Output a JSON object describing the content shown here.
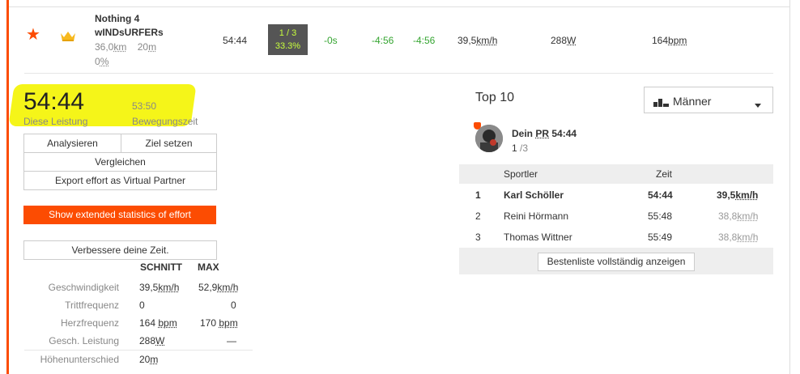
{
  "segment": {
    "name_line1": "Nothing 4",
    "name_line2": "wINDsURFERs",
    "distance": "36,0",
    "distance_unit": "km",
    "elevation": "20",
    "elevation_unit": "m",
    "grade": "0",
    "grade_unit": "%",
    "time": "54:44",
    "rank": "1 / 3",
    "rank_pct": "33.3%",
    "diff1": "-0s",
    "diff2": "-4:56",
    "diff3": "-4:56",
    "speed": "39,5",
    "speed_unit": "km/h",
    "power": "288",
    "power_unit": "W",
    "hr": "164",
    "hr_unit": "bpm"
  },
  "effort": {
    "time": "54:44",
    "time_label": "Diese Leistung",
    "moving_time": "53:50",
    "moving_label": "Bewegungszeit"
  },
  "buttons": {
    "analyze": "Analysieren",
    "set_goal": "Ziel setzen",
    "compare": "Vergleichen",
    "export": "Export effort as Virtual Partner",
    "extended": "Show extended statistics of effort",
    "improve": "Verbessere deine Zeit."
  },
  "stats": {
    "col_avg": "SCHNITT",
    "col_max": "MAX",
    "rows": [
      {
        "label": "Geschwindigkeit",
        "avg": "39,5",
        "avg_unit": "km/h",
        "max": "52,9",
        "max_unit": "km/h"
      },
      {
        "label": "Trittfrequenz",
        "avg": "0",
        "avg_unit": "",
        "max": "0",
        "max_unit": ""
      },
      {
        "label": "Herzfrequenz",
        "avg": "164 ",
        "avg_unit": "bpm",
        "max": "170 ",
        "max_unit": "bpm"
      },
      {
        "label": "Gesch. Leistung",
        "avg": "288",
        "avg_unit": "W",
        "max": "—",
        "max_unit": ""
      },
      {
        "label": "Höhenunterschied",
        "avg": "20",
        "avg_unit": "m",
        "max": "",
        "max_unit": ""
      }
    ]
  },
  "top10": {
    "title": "Top 10",
    "filter": "Männer",
    "pr_prefix": "Dein ",
    "pr_abbr": "PR",
    "pr_time": " 54:44",
    "pr_rank": "1",
    "pr_of": " /3",
    "col_athlete": "Sportler",
    "col_time": "Zeit",
    "rows": [
      {
        "rank": "1",
        "name": "Karl Schöller",
        "time": "54:44",
        "speed": "39,5",
        "unit": "km/h"
      },
      {
        "rank": "2",
        "name": "Reini Hörmann",
        "time": "55:48",
        "speed": "38,8",
        "unit": "km/h"
      },
      {
        "rank": "3",
        "name": "Thomas Wittner",
        "time": "55:49",
        "speed": "38,8",
        "unit": "km/h"
      }
    ],
    "show_all": "Bestenliste vollständig anzeigen"
  },
  "colors": {
    "accent": "#fc4c02",
    "highlight": "#f5f519",
    "rank_bg": "#555555",
    "rank_text": "#c8ff3d",
    "positive": "#35a531"
  },
  "icons": [
    "star-icon",
    "crown-icon",
    "bar-chart-icon",
    "caret-down-icon",
    "avatar"
  ]
}
